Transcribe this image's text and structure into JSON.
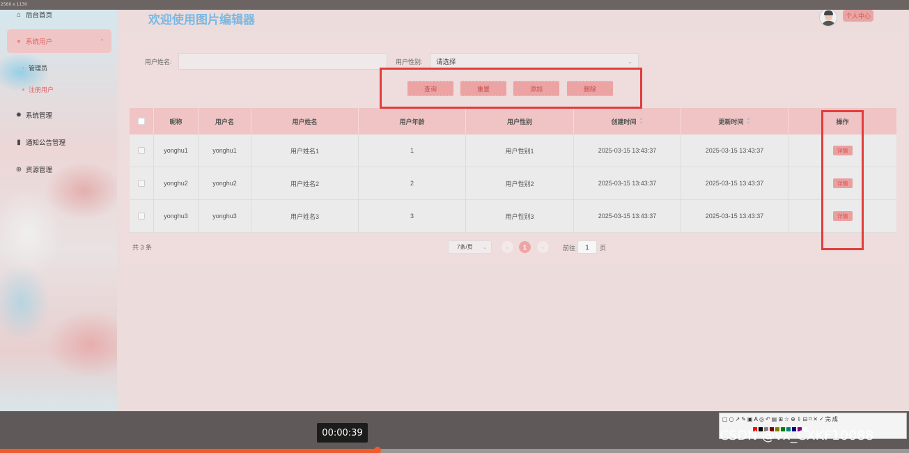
{
  "overlay": {
    "resolution": "2560 x 1130",
    "timestamp": "00:00:39",
    "progress_percent": 41.5,
    "watermark": "CSDN @vx_CXKF10088",
    "screenshot_tools": "□○↗✎▣A◎↶▤⊞☆⊕⇩⊟⌑✕✓完成",
    "colors": [
      "#ff0000",
      "#000000",
      "#808080",
      "#800000",
      "#808000",
      "#008000",
      "#008080",
      "#000080",
      "#800080",
      "#ffffff"
    ]
  },
  "sidebar": {
    "home": "后台首页",
    "system_users": "系统用户",
    "sub_admin": "管理员",
    "sub_registered": "注册用户",
    "system_manage": "系统管理",
    "notice_manage": "通知公告管理",
    "resource_manage": "资源管理"
  },
  "header": {
    "title": "欢迎使用图片编辑器",
    "profile": "个人中心"
  },
  "search": {
    "name_label": "用户姓名:",
    "name_value": "",
    "gender_label": "用户性别:",
    "gender_value": "请选择"
  },
  "buttons": {
    "query": "查询",
    "reset": "重置",
    "add": "添加",
    "delete": "删除"
  },
  "table": {
    "headers": {
      "nickname": "昵称",
      "username": "用户名",
      "realname": "用户姓名",
      "age": "用户年龄",
      "gender": "用户性别",
      "created": "创建时间",
      "updated": "更新时间",
      "ops": "操作"
    },
    "rows": [
      {
        "nickname": "yonghu1",
        "username": "yonghu1",
        "realname": "用户姓名1",
        "age": "1",
        "gender": "用户性别1",
        "created": "2025-03-15 13:43:37",
        "updated": "2025-03-15 13:43:37",
        "action": "详情"
      },
      {
        "nickname": "yonghu2",
        "username": "yonghu2",
        "realname": "用户姓名2",
        "age": "2",
        "gender": "用户性别2",
        "created": "2025-03-15 13:43:37",
        "updated": "2025-03-15 13:43:37",
        "action": "详情"
      },
      {
        "nickname": "yonghu3",
        "username": "yonghu3",
        "realname": "用户姓名3",
        "age": "3",
        "gender": "用户性别3",
        "created": "2025-03-15 13:43:37",
        "updated": "2025-03-15 13:43:37",
        "action": "详情"
      }
    ]
  },
  "pagination": {
    "total": "共 3 条",
    "page_size": "7条/页",
    "current_page": "1",
    "goto_label": "前往",
    "goto_value": "1",
    "goto_suffix": "页"
  }
}
